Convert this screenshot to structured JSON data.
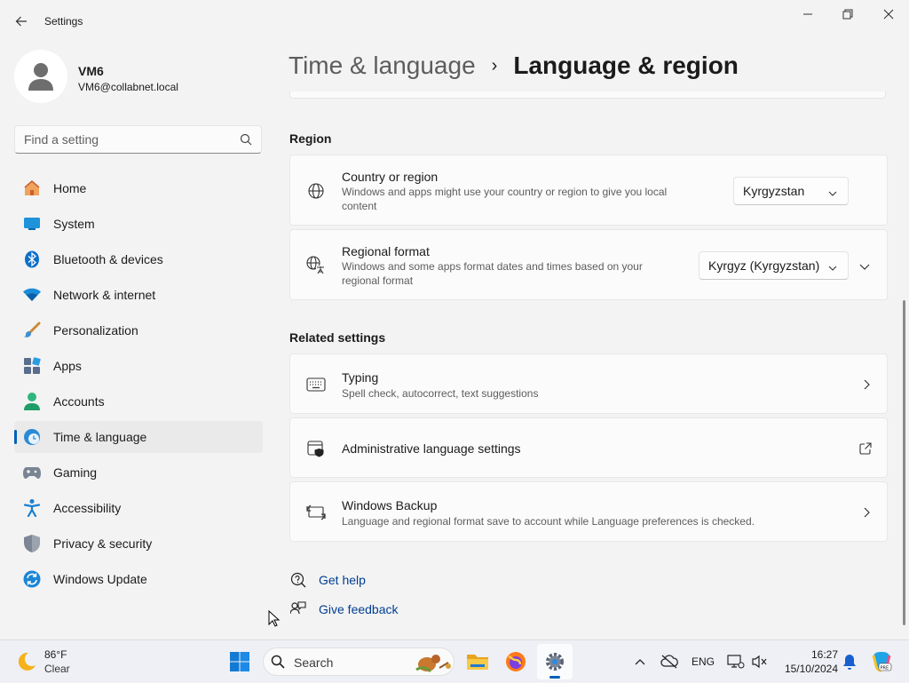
{
  "window": {
    "app_title": "Settings",
    "controls": {
      "minimize": "minimize-icon",
      "maximize": "restore-icon",
      "close": "close-icon"
    }
  },
  "profile": {
    "name": "VM6",
    "email": "VM6@collabnet.local"
  },
  "search": {
    "placeholder": "Find a setting"
  },
  "sidebar": {
    "items": [
      {
        "label": "Home",
        "icon": "home-icon"
      },
      {
        "label": "System",
        "icon": "system-icon"
      },
      {
        "label": "Bluetooth & devices",
        "icon": "bluetooth-icon"
      },
      {
        "label": "Network & internet",
        "icon": "network-icon"
      },
      {
        "label": "Personalization",
        "icon": "brush-icon"
      },
      {
        "label": "Apps",
        "icon": "apps-icon"
      },
      {
        "label": "Accounts",
        "icon": "accounts-icon"
      },
      {
        "label": "Time & language",
        "icon": "time-language-icon",
        "active": true
      },
      {
        "label": "Gaming",
        "icon": "gaming-icon"
      },
      {
        "label": "Accessibility",
        "icon": "accessibility-icon"
      },
      {
        "label": "Privacy & security",
        "icon": "shield-icon"
      },
      {
        "label": "Windows Update",
        "icon": "update-icon"
      }
    ]
  },
  "header": {
    "parent": "Time & language",
    "separator": "›",
    "current": "Language & region"
  },
  "region": {
    "title": "Region",
    "country": {
      "title": "Country or region",
      "desc_line1": "Windows and apps might use your country or region to give you local",
      "desc_line2": "content",
      "value": "Kyrgyzstan"
    },
    "format": {
      "title": "Regional format",
      "desc_line1": "Windows and some apps format dates and times based on your",
      "desc_line2": "regional format",
      "value": "Kyrgyz (Kyrgyzstan)"
    }
  },
  "related": {
    "title": "Related settings",
    "typing": {
      "title": "Typing",
      "desc": "Spell check, autocorrect, text suggestions"
    },
    "admin": {
      "title": "Administrative language settings"
    },
    "backup": {
      "title": "Windows Backup",
      "desc": "Language and regional format save to account while Language preferences is checked."
    }
  },
  "links": {
    "help": "Get help",
    "feedback": "Give feedback"
  },
  "taskbar": {
    "weather_temp": "86°F",
    "weather_cond": "Clear",
    "search_label": "Search",
    "language": "ENG",
    "time": "16:27",
    "date": "15/10/2024"
  },
  "colors": {
    "accent": "#005fb8",
    "link": "#003e92"
  }
}
